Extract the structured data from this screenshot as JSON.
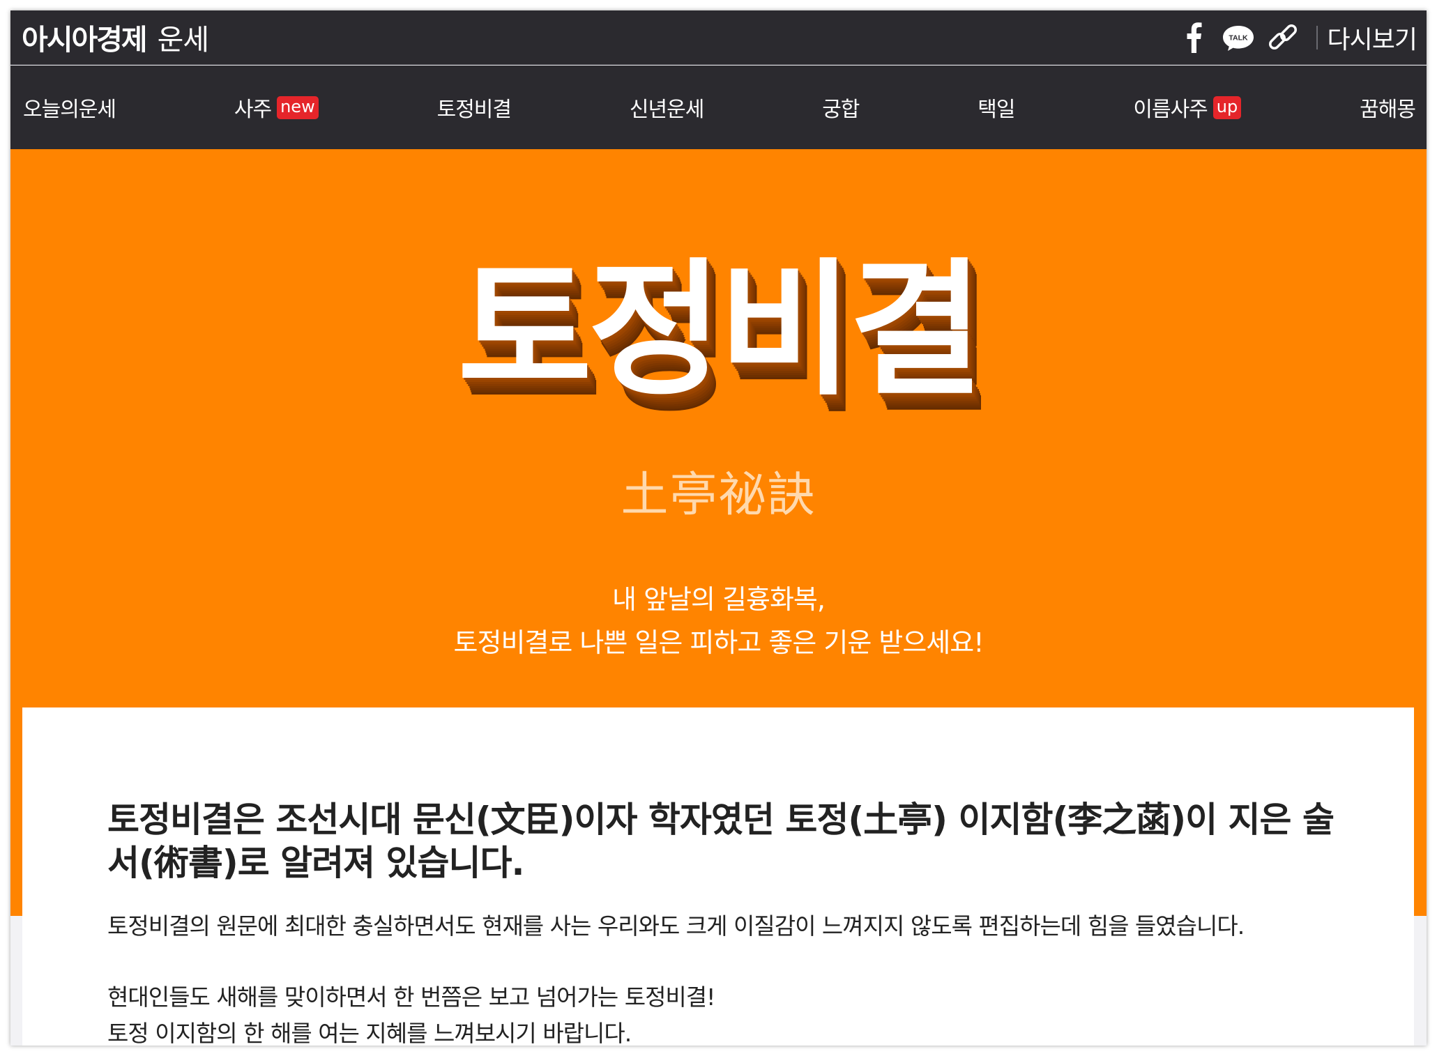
{
  "header": {
    "brand": "아시아경제",
    "section": "운세",
    "share_icons": [
      "facebook-icon",
      "kakaotalk-icon",
      "link-icon"
    ],
    "talk_label": "TALK",
    "replay_label": "다시보기"
  },
  "nav": {
    "items": [
      {
        "label": "오늘의운세",
        "badge": ""
      },
      {
        "label": "사주",
        "badge": "new"
      },
      {
        "label": "토정비결",
        "badge": ""
      },
      {
        "label": "신년운세",
        "badge": ""
      },
      {
        "label": "궁합",
        "badge": ""
      },
      {
        "label": "택일",
        "badge": ""
      },
      {
        "label": "이름사주",
        "badge": "up"
      },
      {
        "label": "꿈해몽",
        "badge": ""
      }
    ]
  },
  "hero": {
    "title": "토정비결",
    "hanja": "土亭祕訣",
    "desc_line1": "내 앞날의 길흉화복,",
    "desc_line2": "토정비결로 나쁜 일은 피하고 좋은 기운 받으세요!"
  },
  "content": {
    "heading": "토정비결은 조선시대 문신(文臣)이자 학자였던 토정(土亭) 이지함(李之菡)이 지은 술서(術書)로 알려져 있습니다.",
    "paragraph1": "토정비결의 원문에 최대한 충실하면서도 현재를 사는 우리와도 크게 이질감이 느껴지지 않도록 편집하는데 힘을 들였습니다.",
    "paragraph2_line1": "현대인들도 새해를 맞이하면서 한 번쯤은 보고 넘어가는 토정비결!",
    "paragraph2_line2": "토정 이지함의 한 해를 여는 지혜를 느껴보시기 바랍니다."
  },
  "colors": {
    "header_bg": "#2b2a2f",
    "hero_bg": "#ff8400",
    "badge_red": "#e5252a",
    "title_shadow": "#7a3600",
    "hanja_color": "#ffd9ad"
  }
}
